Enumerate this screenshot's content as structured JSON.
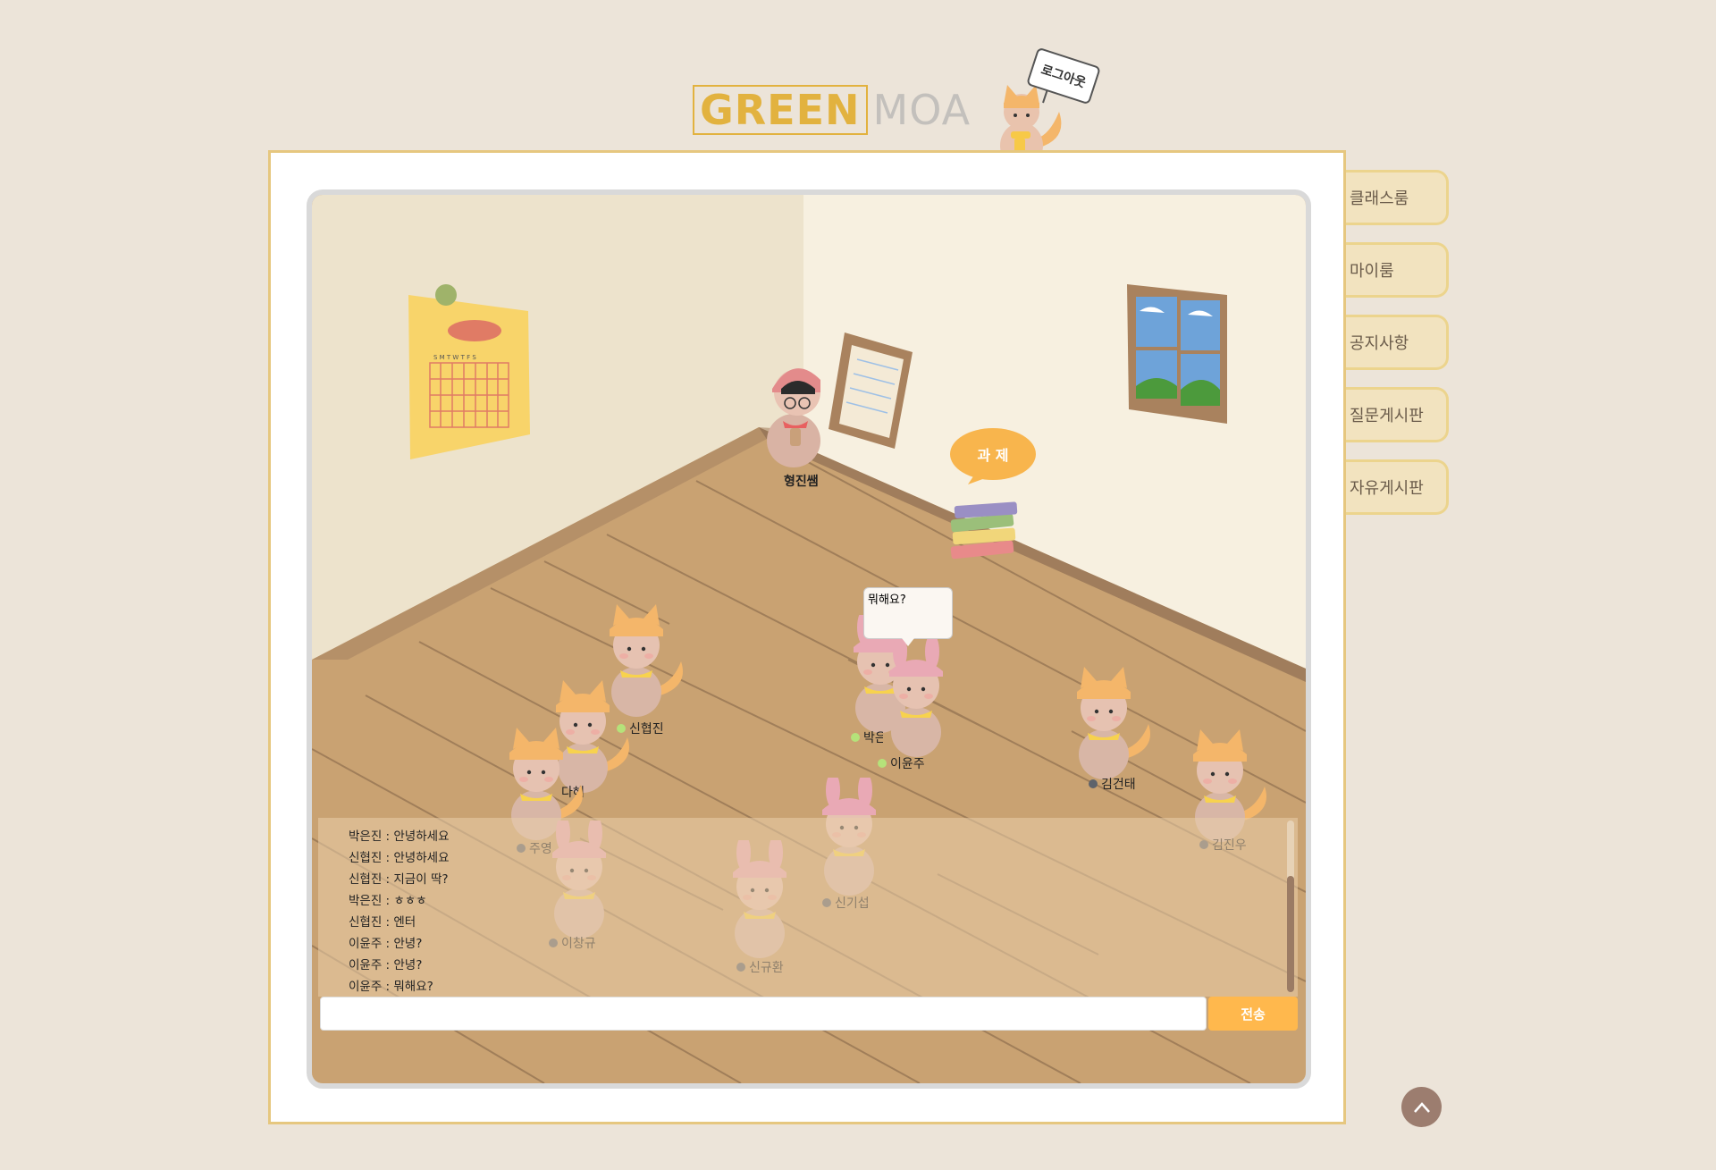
{
  "logo": {
    "part1": "GREEN",
    "part2": "MOA"
  },
  "logout": {
    "label": "로그아웃"
  },
  "nav": [
    {
      "label": "클래스룸"
    },
    {
      "label": "마이룸"
    },
    {
      "label": "공지사항"
    },
    {
      "label": "질문게시판"
    },
    {
      "label": "자유게시판"
    }
  ],
  "room": {
    "task_label": "과 제",
    "speech_text": "뭐해요?",
    "calendar_days": "S M T W T F S"
  },
  "characters": {
    "teacher": "형진쌤",
    "c1": "신협진",
    "c2": "다혜",
    "c3": "주영",
    "c4": "박은진",
    "c5": "이윤주",
    "c6": "김건태",
    "c7": "김진우",
    "c8": "이창규",
    "c9": "신기섭",
    "c10": "신규환"
  },
  "chat": {
    "messages": [
      "박은진 : 안녕하세요",
      "신협진 : 안녕하세요",
      "신협진 : 지금이 딱?",
      "박은진 : ㅎㅎㅎ",
      "신협진 : 엔터",
      "이윤주 : 안녕?",
      "이윤주 : 안녕?",
      "이윤주 : 뭐해요?"
    ],
    "input_value": "",
    "send_label": "전송"
  },
  "colors": {
    "accent": "#e2b23f",
    "send": "#ffb84d",
    "online": "#b5e27a",
    "offline": "#5e636b"
  }
}
